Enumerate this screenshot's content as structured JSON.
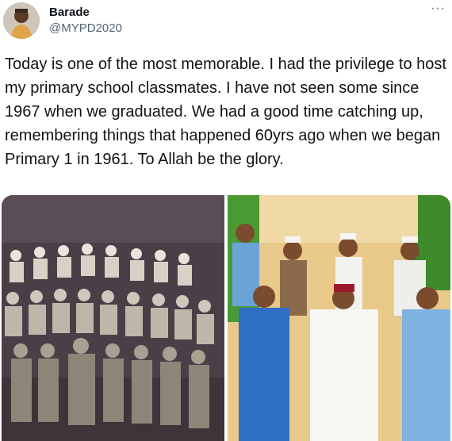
{
  "tweet": {
    "author_name": "Barade",
    "author_handle": "@MYPD2020",
    "more_icon": "···",
    "text": "Today is one of the most memorable. I had the privilege to host my primary school classmates. I have not seen some since 1967 when we graduated. We had a good time catching up, remembering things that happened 60yrs ago when we began Primary 1 in 1961. To Allah be the glory."
  },
  "media": {
    "photos": [
      {
        "name": "old-class-photo",
        "style": "sepia"
      },
      {
        "name": "reunion-photo",
        "style": "color"
      }
    ]
  },
  "colors": {
    "text": "#0f1419",
    "secondary": "#536471",
    "sepia_bg": "#4b3f47",
    "foliage": "#3f8a2a",
    "wall": "#e8c98a"
  }
}
